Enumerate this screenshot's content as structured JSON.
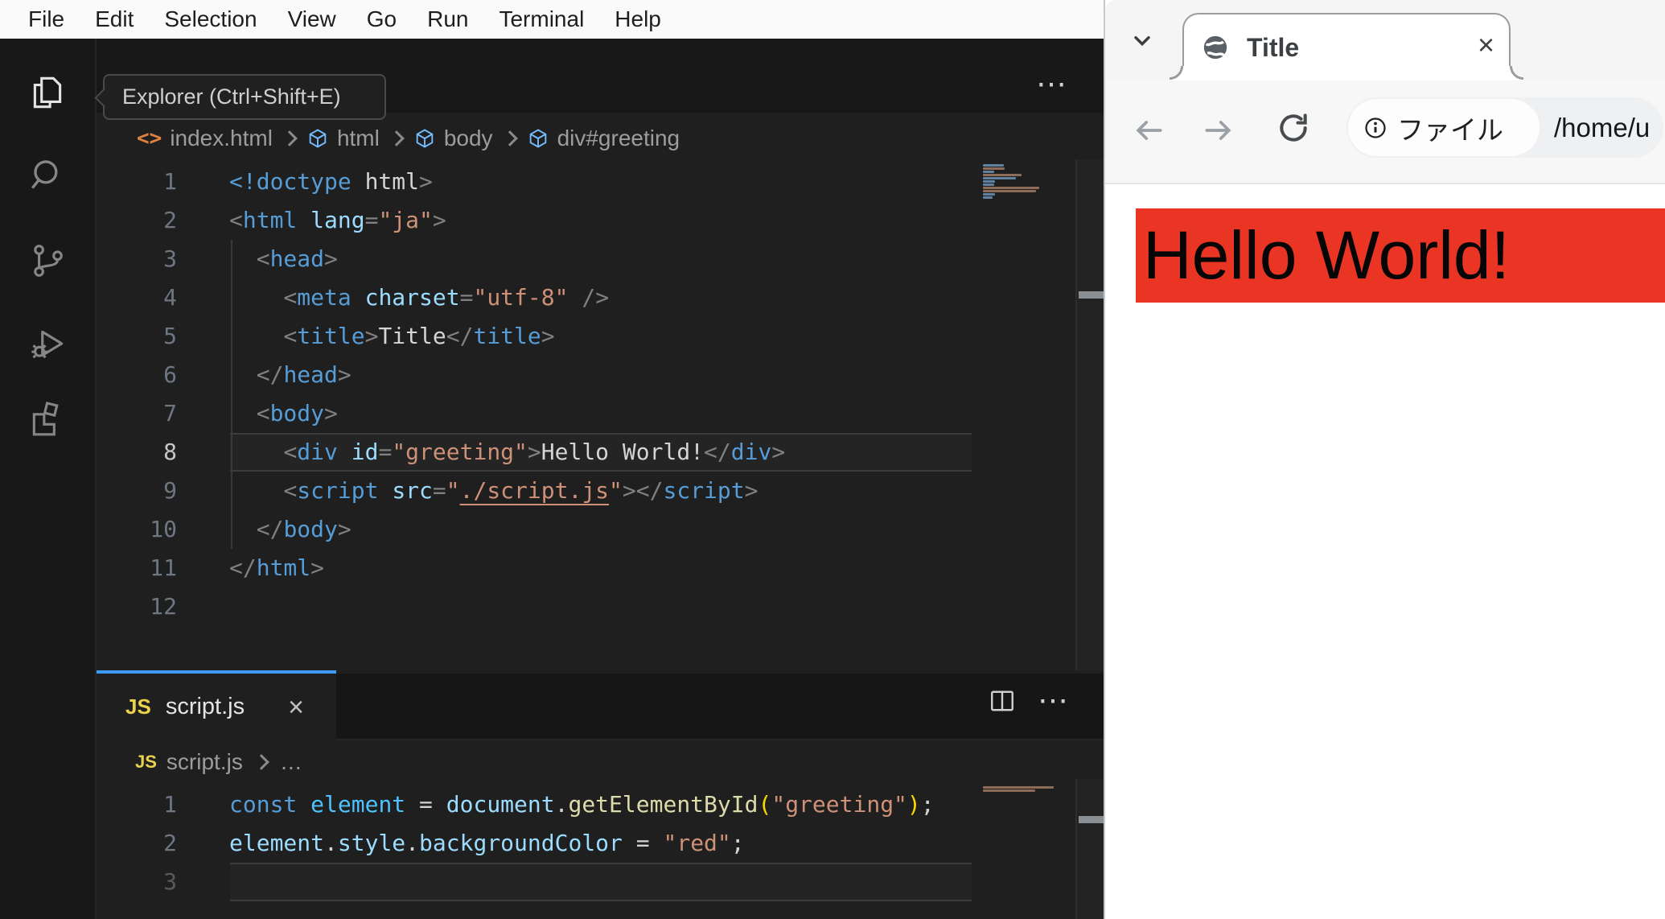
{
  "vscode": {
    "menu": [
      "File",
      "Edit",
      "Selection",
      "View",
      "Go",
      "Run",
      "Terminal",
      "Help"
    ],
    "tooltip": "Explorer (Ctrl+Shift+E)",
    "editor_actions_ellipsis": "⋯",
    "breadcrumb": {
      "file": "index.html",
      "items": [
        "html",
        "body",
        "div#greeting"
      ],
      "file_icon_glyph": "<>"
    },
    "html_editor": {
      "active_line": 8,
      "lines": [
        {
          "n": "1",
          "t": [
            [
              "tag",
              "<!doctype"
            ],
            [
              "text",
              " html"
            ],
            [
              "punc",
              ">"
            ]
          ]
        },
        {
          "n": "2",
          "t": [
            [
              "punc",
              "<"
            ],
            [
              "tag",
              "html"
            ],
            [
              "text",
              " "
            ],
            [
              "attr",
              "lang"
            ],
            [
              "punc",
              "="
            ],
            [
              "str",
              "\"ja\""
            ],
            [
              "punc",
              ">"
            ]
          ]
        },
        {
          "n": "3",
          "t": [
            [
              "text",
              "  "
            ],
            [
              "punc",
              "<"
            ],
            [
              "tag",
              "head"
            ],
            [
              "punc",
              ">"
            ]
          ]
        },
        {
          "n": "4",
          "t": [
            [
              "text",
              "    "
            ],
            [
              "punc",
              "<"
            ],
            [
              "tag",
              "meta"
            ],
            [
              "text",
              " "
            ],
            [
              "attr",
              "charset"
            ],
            [
              "punc",
              "="
            ],
            [
              "str",
              "\"utf-8\""
            ],
            [
              "text",
              " "
            ],
            [
              "punc",
              "/>"
            ]
          ]
        },
        {
          "n": "5",
          "t": [
            [
              "text",
              "    "
            ],
            [
              "punc",
              "<"
            ],
            [
              "tag",
              "title"
            ],
            [
              "punc",
              ">"
            ],
            [
              "text",
              "Title"
            ],
            [
              "punc",
              "</"
            ],
            [
              "tag",
              "title"
            ],
            [
              "punc",
              ">"
            ]
          ]
        },
        {
          "n": "6",
          "t": [
            [
              "text",
              "  "
            ],
            [
              "punc",
              "</"
            ],
            [
              "tag",
              "head"
            ],
            [
              "punc",
              ">"
            ]
          ]
        },
        {
          "n": "7",
          "t": [
            [
              "text",
              "  "
            ],
            [
              "punc",
              "<"
            ],
            [
              "tag",
              "body"
            ],
            [
              "punc",
              ">"
            ]
          ]
        },
        {
          "n": "8",
          "t": [
            [
              "text",
              "    "
            ],
            [
              "punc",
              "<"
            ],
            [
              "tag",
              "div"
            ],
            [
              "text",
              " "
            ],
            [
              "attr",
              "id"
            ],
            [
              "punc",
              "="
            ],
            [
              "str",
              "\"greeting\""
            ],
            [
              "punc",
              ">"
            ],
            [
              "text",
              "Hello World!"
            ],
            [
              "punc",
              "</"
            ],
            [
              "tag",
              "div"
            ],
            [
              "punc",
              ">"
            ]
          ]
        },
        {
          "n": "9",
          "t": [
            [
              "text",
              "    "
            ],
            [
              "punc",
              "<"
            ],
            [
              "tag",
              "script"
            ],
            [
              "text",
              " "
            ],
            [
              "attr",
              "src"
            ],
            [
              "punc",
              "="
            ],
            [
              "str",
              "\""
            ],
            [
              "link",
              "./script.js"
            ],
            [
              "str",
              "\""
            ],
            [
              "punc",
              ">"
            ],
            [
              "punc",
              "</"
            ],
            [
              "tag",
              "script"
            ],
            [
              "punc",
              ">"
            ]
          ]
        },
        {
          "n": "10",
          "t": [
            [
              "text",
              "  "
            ],
            [
              "punc",
              "</"
            ],
            [
              "tag",
              "body"
            ],
            [
              "punc",
              ">"
            ]
          ]
        },
        {
          "n": "11",
          "t": [
            [
              "punc",
              "</"
            ],
            [
              "tag",
              "html"
            ],
            [
              "punc",
              ">"
            ]
          ]
        },
        {
          "n": "12",
          "t": []
        }
      ]
    },
    "panel": {
      "js_badge": "JS",
      "tab_label": "script.js",
      "close_glyph": "×",
      "breadcrumb_file": "script.js",
      "breadcrumb_more": "…",
      "actions_ellipsis": "⋯",
      "active_line": 3,
      "lines": [
        {
          "n": "1",
          "t": [
            [
              "kw",
              "const"
            ],
            [
              "text",
              " "
            ],
            [
              "var",
              "element"
            ],
            [
              "text",
              " = "
            ],
            [
              "attr",
              "document"
            ],
            [
              "text",
              "."
            ],
            [
              "func",
              "getElementById"
            ],
            [
              "gold",
              "("
            ],
            [
              "str",
              "\"greeting\""
            ],
            [
              "gold",
              ")"
            ],
            [
              "text",
              ";"
            ]
          ]
        },
        {
          "n": "2",
          "t": [
            [
              "attr",
              "element"
            ],
            [
              "text",
              "."
            ],
            [
              "attr",
              "style"
            ],
            [
              "text",
              "."
            ],
            [
              "attr",
              "backgroundColor"
            ],
            [
              "text",
              " = "
            ],
            [
              "str",
              "\"red\""
            ],
            [
              "text",
              ";"
            ]
          ]
        },
        {
          "n": "3",
          "t": []
        }
      ]
    }
  },
  "browser": {
    "tab_title": "Title",
    "tab_close_glyph": "×",
    "address": {
      "chip_label": "ファイル",
      "url": "/home/u"
    },
    "content": {
      "text": "Hello World!",
      "bg_color": "#ea3524"
    }
  }
}
